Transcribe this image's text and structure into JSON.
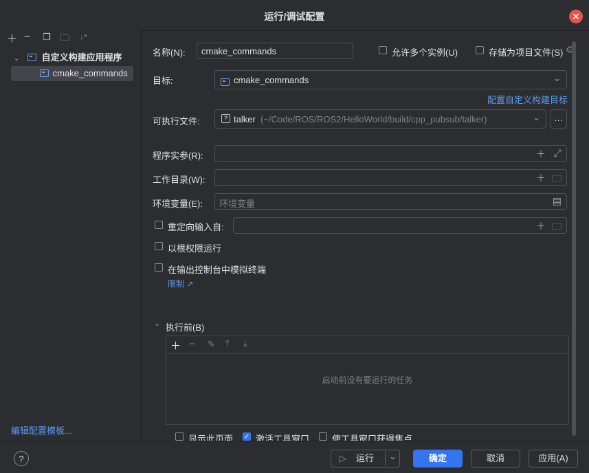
{
  "dialog": {
    "title": "运行/调试配置"
  },
  "sidebar": {
    "tree": {
      "group": "自定义构建应用程序",
      "item": "cmake_commands"
    },
    "edit_templates": "编辑配置模板..."
  },
  "form": {
    "name_label": "名称(N):",
    "name_value": "cmake_commands",
    "allow_multiple": "允许多个实例(U)",
    "store_as_project_file": "存储为项目文件(S)",
    "target_label": "目标:",
    "target_value": "cmake_commands",
    "configure_link": "配置自定义构建目标",
    "exec_label": "可执行文件:",
    "exec_name": "talker",
    "exec_path": "(~/Code/ROS/ROS2/HelloWorld/build/cpp_pubsub/talker)",
    "args_label": "程序实参(R):",
    "workdir_label": "工作目录(W):",
    "env_label": "环境变量(E):",
    "env_placeholder": "环境变量",
    "redirect_label": "重定向输入自:",
    "run_as_root": "以根权限运行",
    "emulate_terminal": "在输出控制台中模拟终端",
    "limit_link": "限制 ↗"
  },
  "before_launch": {
    "header": "执行前(B)",
    "empty_text": "启动前没有要运行的任务",
    "show_page": "显示此页面",
    "activate_tool_window": "激活工具窗口",
    "focus_tool_window": "使工具窗口获得焦点"
  },
  "footer": {
    "help": "?",
    "run": "运行",
    "ok": "确定",
    "cancel": "取消",
    "apply": "应用(A)"
  },
  "colors": {
    "accent": "#3574f0",
    "link": "#5b9cf5",
    "close": "#e5554f",
    "background": "#2b2d30"
  }
}
